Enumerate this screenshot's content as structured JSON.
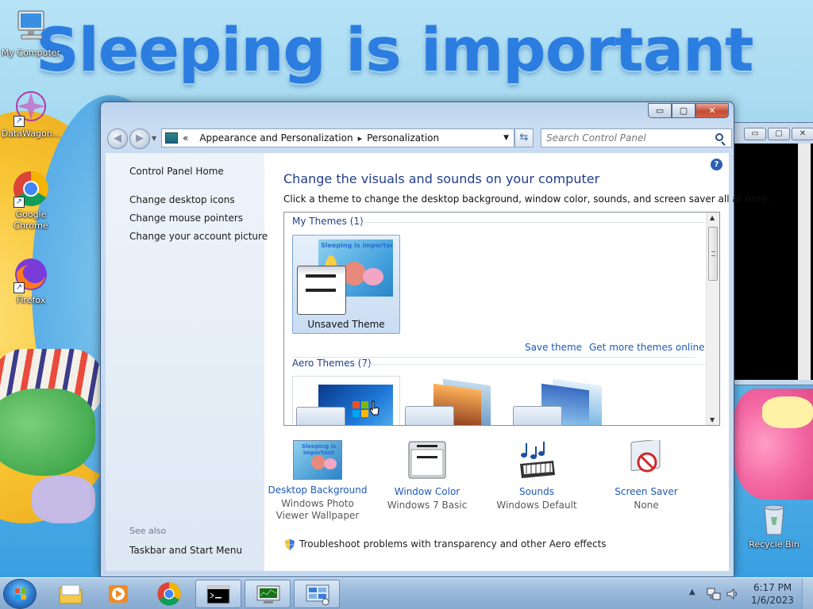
{
  "desktop": {
    "wallpaper_text": "Sleeping is important",
    "icons": [
      {
        "label": "My Computer"
      },
      {
        "label": "DataWagon..."
      },
      {
        "label": "Google Chrome"
      },
      {
        "label": "Firefox"
      },
      {
        "label": "Recycle Bin"
      }
    ]
  },
  "window": {
    "caption_buttons": {
      "minimize": "▭",
      "maximize": "▢",
      "close": "✕"
    },
    "address": {
      "chevron": "«",
      "crumbs": [
        "Appearance and Personalization",
        "Personalization"
      ],
      "separator": "▸"
    },
    "search_placeholder": "Search Control Panel",
    "sidebar": {
      "home": "Control Panel Home",
      "links": [
        "Change desktop icons",
        "Change mouse pointers",
        "Change your account picture"
      ],
      "see_also_label": "See also",
      "see_also_links": [
        "Taskbar and Start Menu"
      ]
    },
    "main": {
      "heading": "Change the visuals and sounds on your computer",
      "subtext": "Click a theme to change the desktop background, window color, sounds, and screen saver all at once.",
      "my_themes_label": "My Themes (1)",
      "unsaved_theme": "Unsaved Theme",
      "preview_text": "Sleeping is important",
      "save_theme": "Save theme",
      "get_more": "Get more themes online",
      "aero_label": "Aero Themes (7)",
      "customizations": [
        {
          "link": "Desktop Background",
          "value": "Windows Photo Viewer Wallpaper"
        },
        {
          "link": "Window Color",
          "value": "Windows 7 Basic"
        },
        {
          "link": "Sounds",
          "value": "Windows Default"
        },
        {
          "link": "Screen Saver",
          "value": "None"
        }
      ],
      "troubleshoot": "Troubleshoot problems with transparency and other Aero effects"
    }
  },
  "taskbar": {
    "time": "6:17 PM",
    "date": "1/6/2023",
    "tray_expand": "▲"
  },
  "colors": {
    "link_blue": "#1e59b8",
    "heading_blue": "#1e3f8a",
    "wallpaper_text": "#2c7de0"
  }
}
